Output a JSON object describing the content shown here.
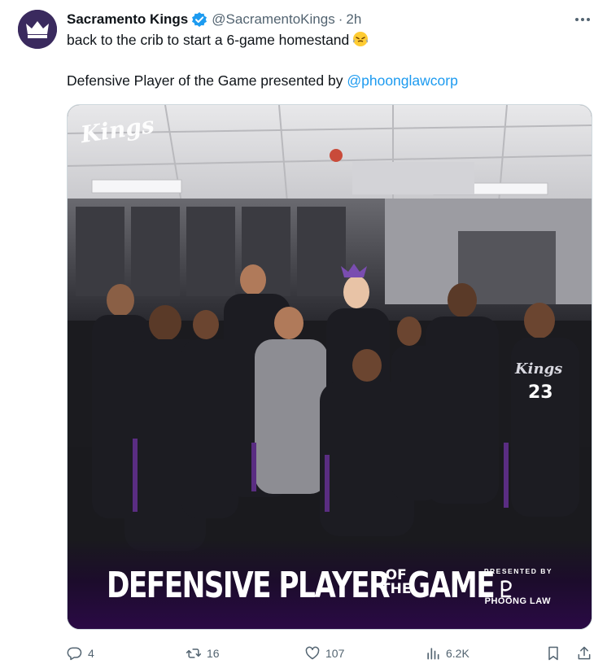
{
  "author": {
    "name": "Sacramento Kings",
    "handle": "@SacramentoKings",
    "separator": "·",
    "time": "2h",
    "verified": true
  },
  "tweet": {
    "line1": "back to the crib to start a 6-game homestand",
    "line2_prefix": "Defensive Player of the Game presented by ",
    "mention": "@phoonglawcorp"
  },
  "media": {
    "wordmark": "Kings",
    "banner_title": "DEFENSIVE PLAYER",
    "banner_of": "OF",
    "banner_the": "THE",
    "banner_game": "GAME",
    "presented_by": "PRESENTED BY",
    "sponsor": "PHOONG LAW",
    "jersey_number": "23",
    "jersey_text": "Kings"
  },
  "metrics": {
    "replies": "4",
    "retweets": "16",
    "likes": "107",
    "views": "6.2K"
  },
  "colors": {
    "link": "#1d9bf0",
    "secondary_text": "#536471",
    "kings_purple": "#5a2d82"
  },
  "icons": [
    "verified-badge-icon",
    "more-icon",
    "steaming-face-emoji-icon",
    "reply-icon",
    "retweet-icon",
    "like-icon",
    "views-icon",
    "bookmark-icon",
    "share-icon",
    "phoong-law-logo-icon"
  ]
}
